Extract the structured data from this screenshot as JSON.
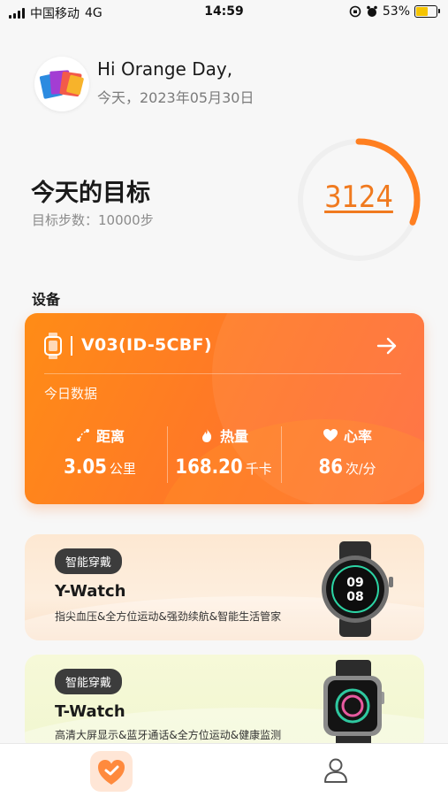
{
  "status_bar": {
    "carrier": "中国移动",
    "network": "4G",
    "time": "14:59",
    "battery": "53%"
  },
  "header": {
    "greeting": "Hi Orange Day,",
    "date": "今天，2023年05月30日"
  },
  "goal": {
    "title": "今天的目标",
    "target_text": "目标步数：10000步",
    "steps": "3124",
    "progress": 0.3124
  },
  "devices_section": {
    "label": "设备"
  },
  "device_card": {
    "name": "V03(ID-5CBF)",
    "today_label": "今日数据",
    "stats": [
      {
        "label": "距离",
        "value": "3.05",
        "unit": "公里",
        "icon": "distance-icon"
      },
      {
        "label": "热量",
        "value": "168.20",
        "unit": "千卡",
        "icon": "flame-icon"
      },
      {
        "label": "心率",
        "value": "86",
        "unit": "次/分",
        "icon": "heart-icon"
      }
    ]
  },
  "promos": [
    {
      "badge": "智能穿戴",
      "title": "Y-Watch",
      "desc": "指尖血压&全方位运动&强劲续航&智能生活管家",
      "watch_time": [
        "09",
        "08"
      ]
    },
    {
      "badge": "智能穿戴",
      "title": "T-Watch",
      "desc": "高清大屏显示&蓝牙通话&全方位运动&健康监测"
    }
  ],
  "tab_bar": {
    "items": [
      "home-tab",
      "profile-tab"
    ]
  },
  "colors": {
    "accent": "#ff7f20",
    "ring_track": "#efefef",
    "steps": "#f07a1f"
  }
}
